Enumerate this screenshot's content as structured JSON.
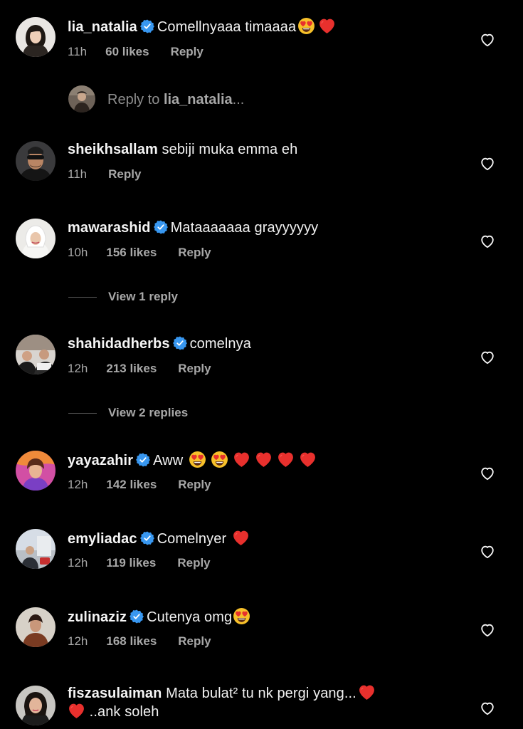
{
  "colors": {
    "background": "#000000",
    "text": "#f5f5f5",
    "muted": "#a8a8a8",
    "verified": "#3897f0",
    "heart_emoji": "#e8302d"
  },
  "comments": [
    {
      "username": "lia_natalia",
      "verified": true,
      "text": "Comellnyaaa timaaaa",
      "emojis": [
        "heart-eyes-emoji",
        "red-heart-emoji"
      ],
      "time": "11h",
      "likes": "60 likes",
      "reply_label": "Reply"
    },
    {
      "username": "sheikhsallam",
      "verified": false,
      "text": "sebiji muka emma eh",
      "time": "11h",
      "likes": "",
      "reply_label": "Reply"
    },
    {
      "username": "mawarashid",
      "verified": true,
      "text": "Mataaaaaaa grayyyyyy",
      "time": "10h",
      "likes": "156 likes",
      "reply_label": "Reply",
      "view_replies": "View 1 reply"
    },
    {
      "username": "shahidadherbs",
      "verified": true,
      "text": "comelnya",
      "time": "12h",
      "likes": "213 likes",
      "reply_label": "Reply",
      "view_replies": "View 2 replies"
    },
    {
      "username": "yayazahir",
      "verified": true,
      "text": "Aww",
      "emojis": [
        "heart-eyes-emoji",
        "heart-eyes-emoji",
        "red-heart-emoji",
        "red-heart-emoji",
        "red-heart-emoji",
        "red-heart-emoji"
      ],
      "time": "12h",
      "likes": "142 likes",
      "reply_label": "Reply"
    },
    {
      "username": "emyliadac",
      "verified": true,
      "text": "Comelnyer",
      "emojis": [
        "red-heart-emoji"
      ],
      "time": "12h",
      "likes": "119 likes",
      "reply_label": "Reply"
    },
    {
      "username": "zulinaziz",
      "verified": true,
      "text": "Cutenya omg",
      "emojis": [
        "heart-eyes-emoji"
      ],
      "time": "12h",
      "likes": "168 likes",
      "reply_label": "Reply"
    },
    {
      "username": "fiszasulaiman",
      "verified": false,
      "text": "Mata bulat² tu nk pergi yang...",
      "text_line2": "..ank soleh",
      "emojis": [
        "red-heart-emoji",
        "red-heart-emoji"
      ]
    }
  ],
  "reply_input": {
    "prefix": "Reply to ",
    "target": "lia_natalia",
    "suffix": "..."
  }
}
